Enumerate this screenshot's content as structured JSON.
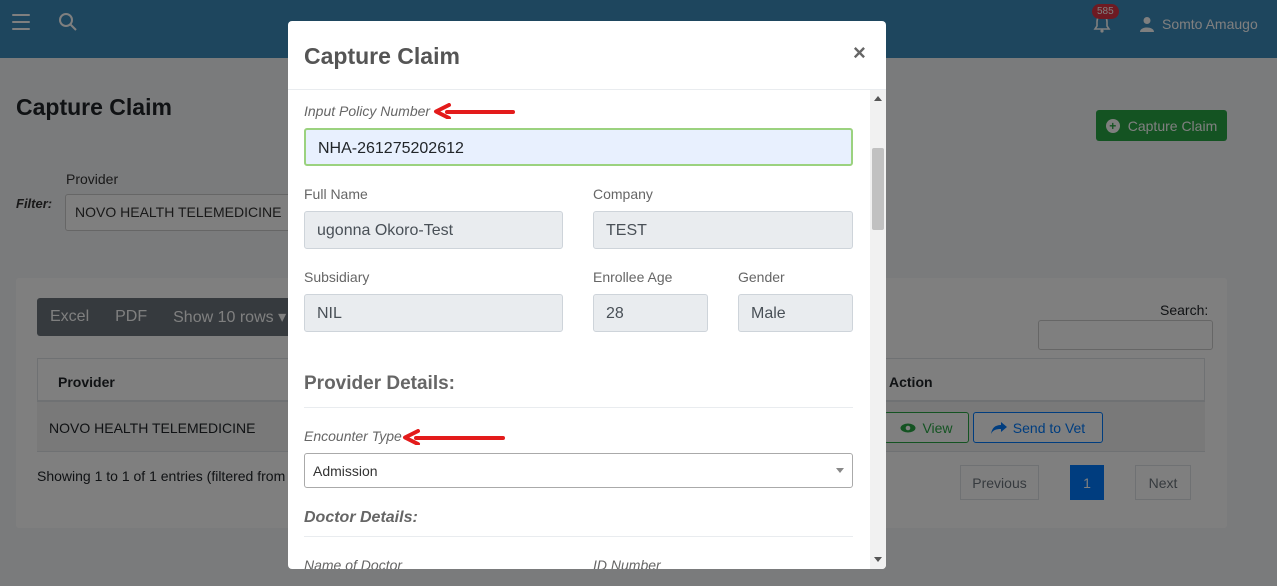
{
  "topbar": {
    "notification_count": "585",
    "user_name": "Somto Amaugo"
  },
  "page": {
    "title": "Capture Claim",
    "capture_button": "Capture Claim",
    "filter_label": "Filter:",
    "provider_label": "Provider",
    "provider_value": "NOVO HEALTH TELEMEDICINE"
  },
  "table": {
    "buttons": [
      "Excel",
      "PDF",
      "Show 10 rows"
    ],
    "search_label": "Search:",
    "columns": {
      "provider": "Provider",
      "action": "Action"
    },
    "rows": [
      {
        "provider": "NOVO HEALTH TELEMEDICINE",
        "view": "View",
        "send": "Send to Vet"
      }
    ],
    "showing": "Showing 1 to 1 of 1 entries (filtered from",
    "pagination": {
      "previous": "Previous",
      "current": "1",
      "next": "Next"
    }
  },
  "modal": {
    "title": "Capture Claim",
    "close": "×",
    "policy_label": "Input Policy Number",
    "policy_value": "NHA-261275202612",
    "full_name_label": "Full Name",
    "full_name_value": "ugonna Okoro-Test",
    "company_label": "Company",
    "company_value": "TEST",
    "subsidiary_label": "Subsidiary",
    "subsidiary_value": "NIL",
    "age_label": "Enrollee Age",
    "age_value": "28",
    "gender_label": "Gender",
    "gender_value": "Male",
    "provider_section": "Provider Details:",
    "encounter_label": "Encounter Type",
    "encounter_value": "Admission",
    "doctor_section": "Doctor Details:",
    "doctor_name_label": "Name of Doctor",
    "id_number_label": "ID Number"
  },
  "colors": {
    "topbar": "#3c8dbc",
    "success": "#28a745",
    "primary": "#007bff",
    "annotation_arrow": "#e31b1b"
  }
}
